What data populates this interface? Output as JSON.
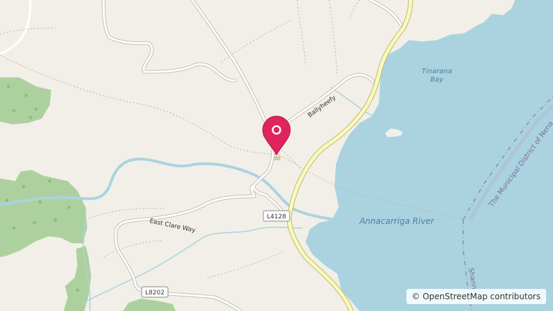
{
  "map": {
    "place_labels": {
      "bay": [
        "Tinarana",
        "Bay"
      ],
      "river": "Annacarriga River",
      "boundary": "The Municipal District of Nena",
      "boundary_lower": "Shann"
    },
    "road_labels": {
      "ballyheefy": "Ballyheefy",
      "trail": "East Clare Way"
    },
    "road_refs": {
      "r1": "L4128",
      "r2": "L8202"
    },
    "marker": {
      "icon": "map-pin-icon",
      "color": "#e0245e"
    },
    "attribution": "© OpenStreetMap contributors",
    "colors": {
      "land": "#f2efe9",
      "water": "#aad3df",
      "woods": "#add19e",
      "major_road": "#f7fabf",
      "major_road_casing": "#c6b56a",
      "minor_road": "#ffffff",
      "minor_road_casing": "#c4bfb4"
    }
  }
}
